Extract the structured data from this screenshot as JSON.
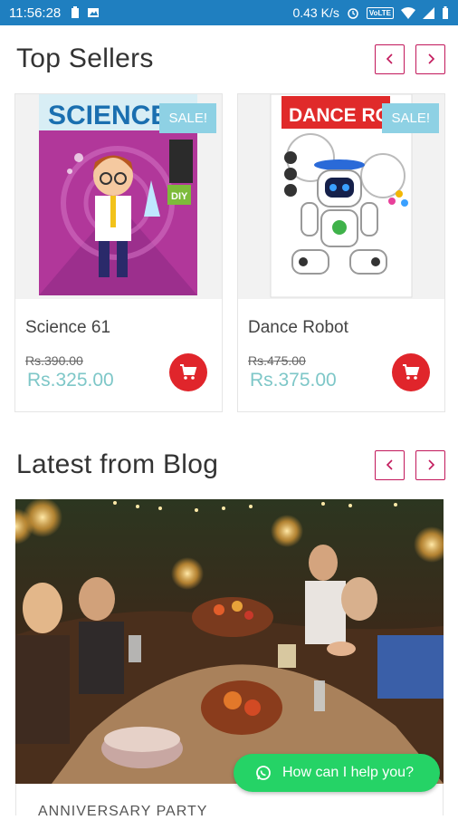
{
  "status_bar": {
    "time": "11:56:28",
    "network_speed": "0.43 K/s",
    "volte": "VoLTE"
  },
  "top_sellers": {
    "title": "Top Sellers",
    "products": [
      {
        "cover_text": "SCIENCE 61",
        "badge": "SALE!",
        "name": "Science 61",
        "old_price": "Rs.390.00",
        "price": "Rs.325.00"
      },
      {
        "cover_text": "DANCE ROBOT",
        "badge": "SALE!",
        "name": "Dance Robot",
        "old_price": "Rs.475.00",
        "price": "Rs.375.00"
      }
    ]
  },
  "blog": {
    "title": "Latest from Blog",
    "post_title": "ANNIVERSARY PARTY"
  },
  "whatsapp": {
    "label": "How can I help you?"
  },
  "colors": {
    "status_bar": "#1f7fc0",
    "nav_border": "#c2185b",
    "sale_badge": "#8ed1e4",
    "price": "#7ec7c8",
    "cart_button": "#e0252b",
    "whatsapp": "#25d366"
  }
}
